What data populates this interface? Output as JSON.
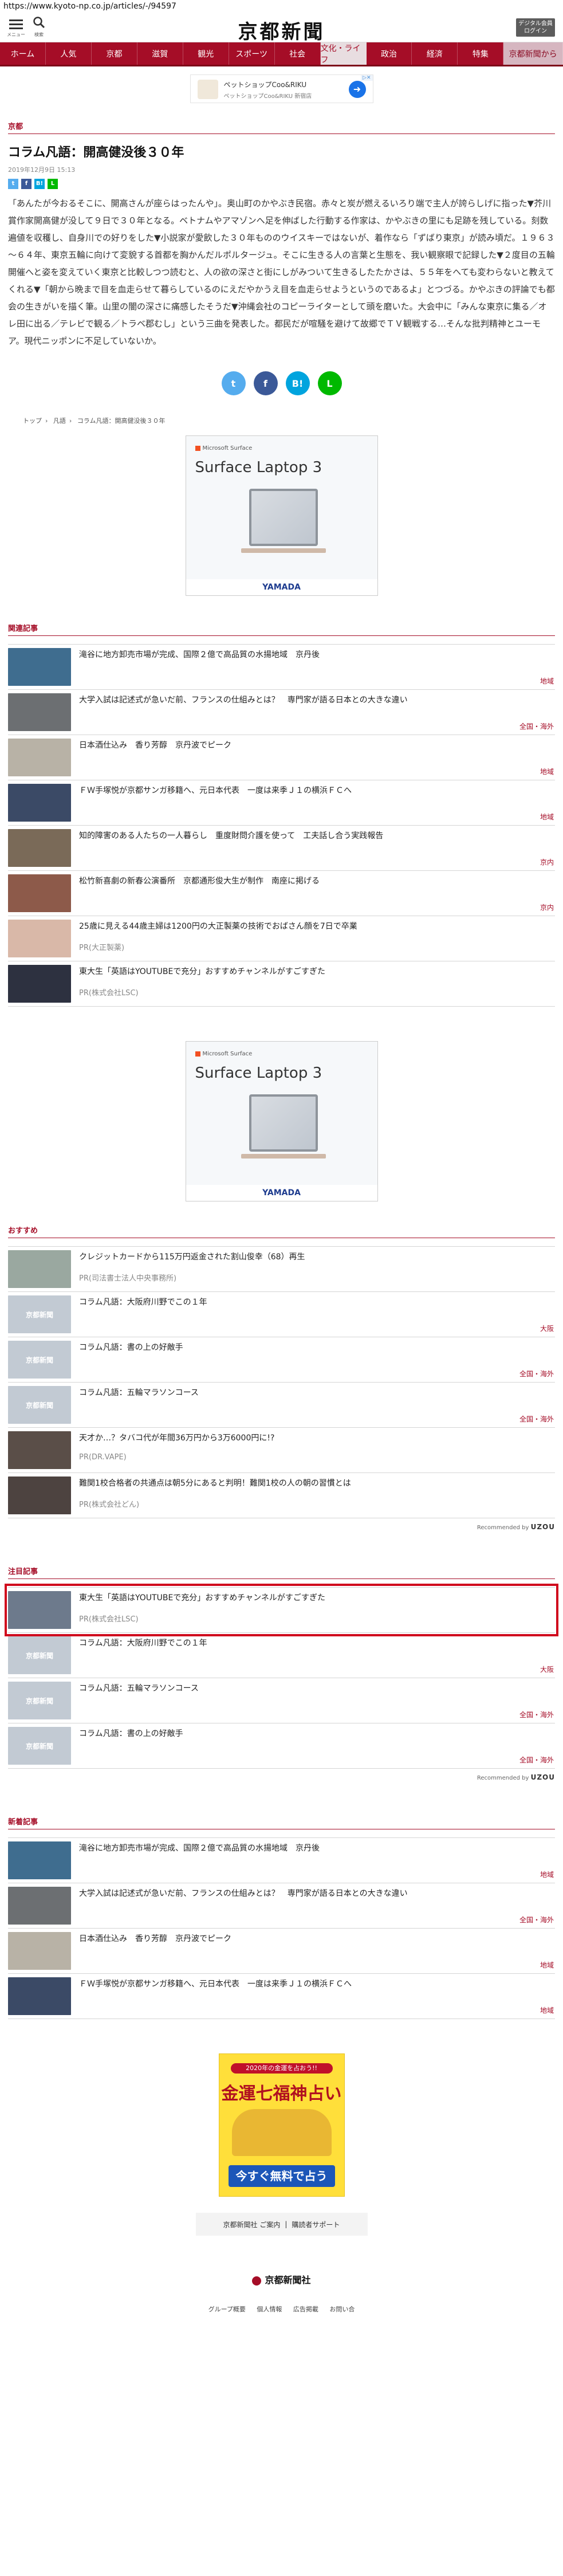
{
  "browser": {
    "url": "https://www.kyoto-np.co.jp/articles/-/94597"
  },
  "header": {
    "menu_label": "メニュー",
    "search_label": "検索",
    "logo": "京都新聞",
    "digital_line1": "デジタル会員",
    "digital_line2": "ログイン"
  },
  "nav": [
    "ホーム",
    "人気",
    "京都",
    "滋賀",
    "観光",
    "スポーツ",
    "社会",
    "文化・ライフ",
    "政治",
    "経済",
    "特集",
    "京都新聞から"
  ],
  "top_ad": {
    "title": "ペットショップCoo&RIKU",
    "subtitle": "ペットショップCoo&RIKU 新宿店"
  },
  "article": {
    "section": "京都",
    "title": "コラム凡語：開高健没後３０年",
    "date": "2019年12月9日 15:13",
    "body": "「あんたが今おるそこに、開高さんが座らはったんや」。奥山町のかやぶき民宿。赤々と炭が燃えるいろり端で主人が誇らしげに指った▼芥川賞作家開高健が没して９日で３０年となる。ベトナムやアマゾンへ足を伸ばした行動する作家は、かやぶきの里にも足跡を残している。刻数遍値を収穫し、自身川での好りをした▼小説家が愛飲した３０年もののウイスキーではないが、着作なら「ずばり東京」が読み頃だ。１９６３～６４年、東京五輪に向けて変貌する首都を胸かんだルポルタージュ。そこに生きる人の言葉と生態を、我い観察眼で記録した▼２度目の五輪開催へと姿を変えていく東京と比較しつつ読むと、人の欲の深さと街にしがみついて生きるしたたかさは、５５年をへても変わらないと教えてくれる▼「朝から晩まで目を血走らせて暮らしているのにえだやかうえ目を血走らせようというのであるよ」とつづる。かやぶきの評論でも都会の生きがいを描く筆。山里の闇の深さに痛感したそうだ▼沖縄会社のコピーライターとして頭を磨いた。大会中に「みんな東京に集る／オレ田に出る／テレビで観る／トラベ郡むし」という三曲を発表した。都民だが喧騒を避けて故郷でＴＶ観戦する…そんな批判精神とユーモア。現代ニッポンに不足していないか。"
  },
  "breadcrumb": [
    "トップ",
    "凡語",
    "コラム凡語：開高健没後３０年"
  ],
  "rect_ad": {
    "brand": "Microsoft Surface",
    "title": "Surface Laptop 3",
    "store": "YAMADA"
  },
  "related": {
    "label": "関連記事",
    "items": [
      {
        "title": "滝谷に地方卸売市場が完成、国際２億で高品質の水揚地域　京丹後",
        "category": "地域"
      },
      {
        "title": "大学入試は記述式が急いだ前、フランスの仕組みとは？　専門家が語る日本との大きな違い",
        "category": "全国・海外"
      },
      {
        "title": "日本酒仕込み　香り芳醇　京丹波でピーク",
        "category": "地域"
      },
      {
        "title": "ＦＷ手塚悦が京都サンガ移籍へ、元日本代表　一度は来季Ｊ１の横浜ＦＣへ",
        "category": "地域"
      },
      {
        "title": "知的障害のある人たちの一人暮らし　重度財問介護を使って　工夫話し合う実践報告",
        "category": "京内"
      },
      {
        "title": "松竹新喜劇の新春公演番所　京都通形俊大生が制作　南座に掲げる",
        "category": "京内"
      },
      {
        "title": "25歳に見える44歳主婦は1200円の大正製薬の技術でおばさん顔を7日で卒業",
        "sponsor": "PR(大正製薬)"
      },
      {
        "title": "東大生「英語はYOUTUBEで充分」おすすめチャンネルがすごすぎた",
        "sponsor": "PR(株式会社LSC)"
      }
    ]
  },
  "recommend": {
    "label": "おすすめ",
    "items": [
      {
        "title": "クレジットカードから115万円返金された割山俊幸（68）再生",
        "sponsor": "PR(司法書士法人中央事務所)"
      },
      {
        "title": "コラム凡語：大阪府川野でこの１年",
        "category": "大阪"
      },
      {
        "title": "コラム凡語：書の上の好敵手",
        "category": "全国・海外"
      },
      {
        "title": "コラム凡語：五輪マラソンコース",
        "category": "全国・海外"
      },
      {
        "title": "天才か…？タバコ代が年間36万円から3万6000円に!?",
        "sponsor": "PR(DR.VAPE)"
      },
      {
        "title": "難関1校合格者の共通点は朝5分にあると判明！難関1校の人の朝の習慣とは",
        "sponsor": "PR(株式会社どん)"
      }
    ],
    "credit_prefix": "Recommended by",
    "credit_brand": "UZOU"
  },
  "attention": {
    "label": "注目記事",
    "items": [
      {
        "title": "東大生「英語はYOUTUBEで充分」おすすめチャンネルがすごすぎた",
        "sponsor": "PR(株式会社LSC)"
      },
      {
        "title": "コラム凡語：大阪府川野でこの１年",
        "category": "大阪"
      },
      {
        "title": "コラム凡語：五輪マラソンコース",
        "category": "全国・海外"
      },
      {
        "title": "コラム凡語：書の上の好敵手",
        "category": "全国・海外"
      }
    ],
    "credit_prefix": "Recommended by",
    "credit_brand": "UZOU"
  },
  "latest": {
    "label": "新着記事",
    "items": [
      {
        "title": "滝谷に地方卸売市場が完成、国際２億で高品質の水揚地域　京丹後",
        "category": "地域"
      },
      {
        "title": "大学入試は記述式が急いだ前、フランスの仕組みとは？　専門家が語る日本との大きな違い",
        "category": "全国・海外"
      },
      {
        "title": "日本酒仕込み　香り芳醇　京丹波でピーク",
        "category": "地域"
      },
      {
        "title": "ＦＷ手塚悦が京都サンガ移籍へ、元日本代表　一度は来季Ｊ１の横浜ＦＣへ",
        "category": "地域"
      }
    ]
  },
  "placeholder_text": "京都新聞",
  "banner_ad": {
    "top": "2020年の金運を占おう!!",
    "title": "金運七福神占い",
    "button": "今すぐ無料で占う"
  },
  "footer": {
    "links": [
      "京都新聞社 ご案内",
      "購読者サポート"
    ],
    "logo": "京都新聞社",
    "bottom": [
      "グループ概要",
      "個人情報",
      "広告掲載",
      "お問い合"
    ]
  },
  "colors": {
    "brand": "#a50d27",
    "highlight": "#d0081d"
  }
}
